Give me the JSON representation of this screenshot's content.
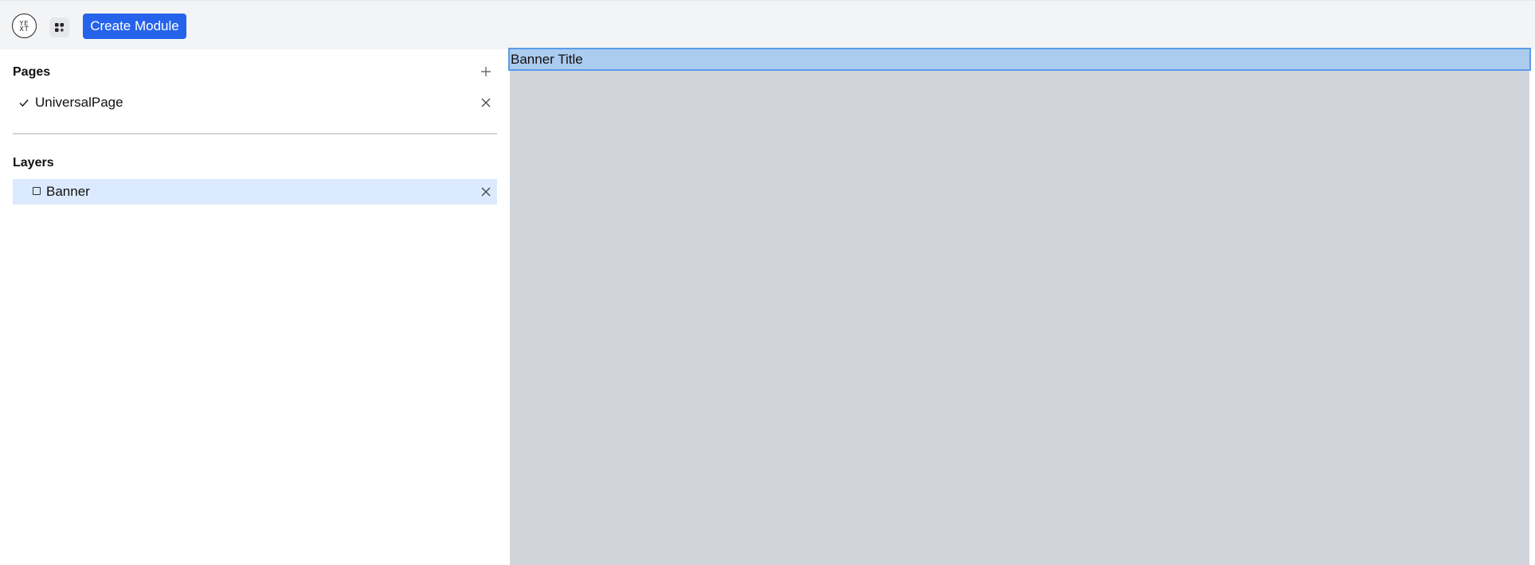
{
  "header": {
    "logo_text_top": "YE",
    "logo_text_bottom": "XT",
    "create_button_label": "Create Module"
  },
  "sidebar": {
    "pages_title": "Pages",
    "pages": [
      {
        "label": "UniversalPage",
        "selected": true
      }
    ],
    "layers_title": "Layers",
    "layers": [
      {
        "label": "Banner",
        "selected": true
      }
    ]
  },
  "canvas": {
    "banner_title": "Banner Title"
  },
  "colors": {
    "accent": "#2563eb",
    "topbar_bg": "#f3f4f6",
    "canvas_bg": "#d1d5db",
    "selected_layer_bg": "#dbeafe",
    "banner_bg": "#abcbef",
    "banner_border": "#5b9be6"
  },
  "icons": [
    "yext-logo-icon",
    "grid-icon",
    "plus-icon",
    "check-icon",
    "close-icon",
    "square-icon"
  ]
}
